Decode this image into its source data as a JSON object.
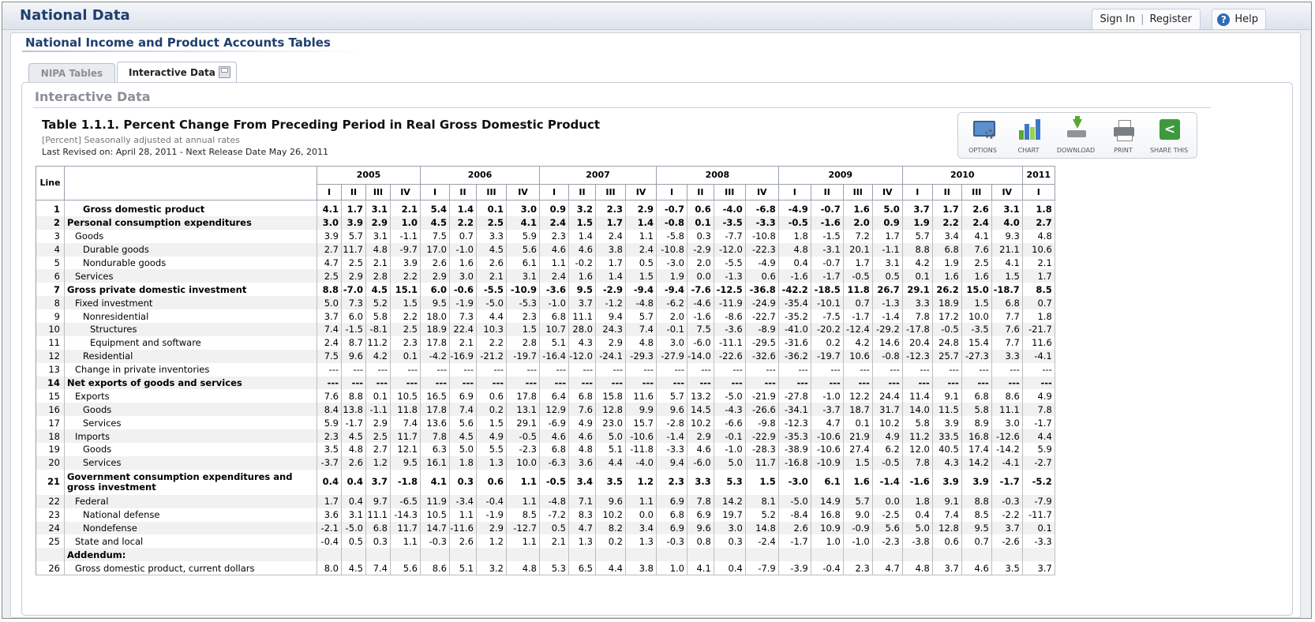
{
  "app": {
    "title": "National Data"
  },
  "auth": {
    "sign_in": "Sign In",
    "register": "Register",
    "help": "Help"
  },
  "panel": {
    "title": "National Income and Product Accounts Tables"
  },
  "tabs": [
    {
      "label": "NIPA Tables"
    },
    {
      "label": "Interactive Data"
    }
  ],
  "section": {
    "title": "Interactive Data"
  },
  "table_meta": {
    "title": "Table 1.1.1. Percent Change From Preceding Period in Real Gross Domestic Product",
    "subtitle": "[Percent] Seasonally adjusted at annual rates",
    "revised": "Last Revised on: April 28, 2011 - Next Release Date May 26, 2011"
  },
  "toolbar": {
    "options": "OPTIONS",
    "chart": "CHART",
    "download": "DOWNLOAD",
    "print": "PRINT",
    "share": "SHARE THIS"
  },
  "icons": {
    "options": "options-icon",
    "chart": "chart-icon",
    "download": "download-icon",
    "print": "print-icon",
    "share": "share-icon",
    "save": "save-icon",
    "help": "help-icon"
  },
  "colors": {
    "title": "#1f3f6e",
    "row_alt": "#f1f1f1",
    "share_green": "#3c9a3c",
    "chart_bars": [
      "#5aa832",
      "#3c78c8",
      "#9ccc5a"
    ]
  },
  "columns": {
    "line_header": "Line",
    "years": [
      {
        "year": "2005",
        "span": 4
      },
      {
        "year": "2006",
        "span": 4
      },
      {
        "year": "2007",
        "span": 4
      },
      {
        "year": "2008",
        "span": 4
      },
      {
        "year": "2009",
        "span": 4
      },
      {
        "year": "2010",
        "span": 4
      },
      {
        "year": "2011",
        "span": 1
      }
    ],
    "quarters": [
      "I",
      "II",
      "III",
      "IV",
      "I",
      "II",
      "III",
      "IV",
      "I",
      "II",
      "III",
      "IV",
      "I",
      "II",
      "III",
      "IV",
      "I",
      "II",
      "III",
      "IV",
      "I",
      "II",
      "III",
      "IV",
      "I"
    ]
  },
  "rows": [
    {
      "line": "1",
      "label": "Gross domestic product",
      "indent": 2,
      "bold": true,
      "values": [
        "4.1",
        "1.7",
        "3.1",
        "2.1",
        "5.4",
        "1.4",
        "0.1",
        "3.0",
        "0.9",
        "3.2",
        "2.3",
        "2.9",
        "-0.7",
        "0.6",
        "-4.0",
        "-6.8",
        "-4.9",
        "-0.7",
        "1.6",
        "5.0",
        "3.7",
        "1.7",
        "2.6",
        "3.1",
        "1.8"
      ]
    },
    {
      "line": "2",
      "label": "Personal consumption expenditures",
      "indent": 0,
      "bold": true,
      "values": [
        "3.0",
        "3.9",
        "2.9",
        "1.0",
        "4.5",
        "2.2",
        "2.5",
        "4.1",
        "2.4",
        "1.5",
        "1.7",
        "1.4",
        "-0.8",
        "0.1",
        "-3.5",
        "-3.3",
        "-0.5",
        "-1.6",
        "2.0",
        "0.9",
        "1.9",
        "2.2",
        "2.4",
        "4.0",
        "2.7"
      ]
    },
    {
      "line": "3",
      "label": "Goods",
      "indent": 1,
      "bold": false,
      "values": [
        "3.9",
        "5.7",
        "3.1",
        "-1.1",
        "7.5",
        "0.7",
        "3.3",
        "5.9",
        "2.3",
        "1.4",
        "2.4",
        "1.1",
        "-5.8",
        "0.3",
        "-7.7",
        "-10.8",
        "1.8",
        "-1.5",
        "7.2",
        "1.7",
        "5.7",
        "3.4",
        "4.1",
        "9.3",
        "4.8"
      ]
    },
    {
      "line": "4",
      "label": "Durable goods",
      "indent": 2,
      "bold": false,
      "values": [
        "2.7",
        "11.7",
        "4.8",
        "-9.7",
        "17.0",
        "-1.0",
        "4.5",
        "5.6",
        "4.6",
        "4.6",
        "3.8",
        "2.4",
        "-10.8",
        "-2.9",
        "-12.0",
        "-22.3",
        "4.8",
        "-3.1",
        "20.1",
        "-1.1",
        "8.8",
        "6.8",
        "7.6",
        "21.1",
        "10.6"
      ]
    },
    {
      "line": "5",
      "label": "Nondurable goods",
      "indent": 2,
      "bold": false,
      "values": [
        "4.7",
        "2.5",
        "2.1",
        "3.9",
        "2.6",
        "1.6",
        "2.6",
        "6.1",
        "1.1",
        "-0.2",
        "1.7",
        "0.5",
        "-3.0",
        "2.0",
        "-5.5",
        "-4.9",
        "0.4",
        "-0.7",
        "1.7",
        "3.1",
        "4.2",
        "1.9",
        "2.5",
        "4.1",
        "2.1"
      ]
    },
    {
      "line": "6",
      "label": "Services",
      "indent": 1,
      "bold": false,
      "values": [
        "2.5",
        "2.9",
        "2.8",
        "2.2",
        "2.9",
        "3.0",
        "2.1",
        "3.1",
        "2.4",
        "1.6",
        "1.4",
        "1.5",
        "1.9",
        "0.0",
        "-1.3",
        "0.6",
        "-1.6",
        "-1.7",
        "-0.5",
        "0.5",
        "0.1",
        "1.6",
        "1.6",
        "1.5",
        "1.7"
      ]
    },
    {
      "line": "7",
      "label": "Gross private domestic investment",
      "indent": 0,
      "bold": true,
      "values": [
        "8.8",
        "-7.0",
        "4.5",
        "15.1",
        "6.0",
        "-0.6",
        "-5.5",
        "-10.9",
        "-3.6",
        "9.5",
        "-2.9",
        "-9.4",
        "-9.4",
        "-7.6",
        "-12.5",
        "-36.8",
        "-42.2",
        "-18.5",
        "11.8",
        "26.7",
        "29.1",
        "26.2",
        "15.0",
        "-18.7",
        "8.5"
      ]
    },
    {
      "line": "8",
      "label": "Fixed investment",
      "indent": 1,
      "bold": false,
      "values": [
        "5.0",
        "7.3",
        "5.2",
        "1.5",
        "9.5",
        "-1.9",
        "-5.0",
        "-5.3",
        "-1.0",
        "3.7",
        "-1.2",
        "-4.8",
        "-6.2",
        "-4.6",
        "-11.9",
        "-24.9",
        "-35.4",
        "-10.1",
        "0.7",
        "-1.3",
        "3.3",
        "18.9",
        "1.5",
        "6.8",
        "0.7"
      ]
    },
    {
      "line": "9",
      "label": "Nonresidential",
      "indent": 2,
      "bold": false,
      "values": [
        "3.7",
        "6.0",
        "5.8",
        "2.2",
        "18.0",
        "7.3",
        "4.4",
        "2.3",
        "6.8",
        "11.1",
        "9.4",
        "5.7",
        "2.0",
        "-1.6",
        "-8.6",
        "-22.7",
        "-35.2",
        "-7.5",
        "-1.7",
        "-1.4",
        "7.8",
        "17.2",
        "10.0",
        "7.7",
        "1.8"
      ]
    },
    {
      "line": "10",
      "label": "Structures",
      "indent": 3,
      "bold": false,
      "values": [
        "7.4",
        "-1.5",
        "-8.1",
        "2.5",
        "18.9",
        "22.4",
        "10.3",
        "1.5",
        "10.7",
        "28.0",
        "24.3",
        "7.4",
        "-0.1",
        "7.5",
        "-3.6",
        "-8.9",
        "-41.0",
        "-20.2",
        "-12.4",
        "-29.2",
        "-17.8",
        "-0.5",
        "-3.5",
        "7.6",
        "-21.7"
      ]
    },
    {
      "line": "11",
      "label": "Equipment and software",
      "indent": 3,
      "bold": false,
      "values": [
        "2.4",
        "8.7",
        "11.2",
        "2.3",
        "17.8",
        "2.1",
        "2.2",
        "2.8",
        "5.1",
        "4.3",
        "2.9",
        "4.8",
        "3.0",
        "-6.0",
        "-11.1",
        "-29.5",
        "-31.6",
        "0.2",
        "4.2",
        "14.6",
        "20.4",
        "24.8",
        "15.4",
        "7.7",
        "11.6"
      ]
    },
    {
      "line": "12",
      "label": "Residential",
      "indent": 2,
      "bold": false,
      "values": [
        "7.5",
        "9.6",
        "4.2",
        "0.1",
        "-4.2",
        "-16.9",
        "-21.2",
        "-19.7",
        "-16.4",
        "-12.0",
        "-24.1",
        "-29.3",
        "-27.9",
        "-14.0",
        "-22.6",
        "-32.6",
        "-36.2",
        "-19.7",
        "10.6",
        "-0.8",
        "-12.3",
        "25.7",
        "-27.3",
        "3.3",
        "-4.1"
      ]
    },
    {
      "line": "13",
      "label": "Change in private inventories",
      "indent": 1,
      "bold": false,
      "values": [
        "---",
        "---",
        "---",
        "---",
        "---",
        "---",
        "---",
        "---",
        "---",
        "---",
        "---",
        "---",
        "---",
        "---",
        "---",
        "---",
        "---",
        "---",
        "---",
        "---",
        "---",
        "---",
        "---",
        "---",
        "---"
      ]
    },
    {
      "line": "14",
      "label": "Net exports of goods and services",
      "indent": 0,
      "bold": true,
      "values": [
        "---",
        "---",
        "---",
        "---",
        "---",
        "---",
        "---",
        "---",
        "---",
        "---",
        "---",
        "---",
        "---",
        "---",
        "---",
        "---",
        "---",
        "---",
        "---",
        "---",
        "---",
        "---",
        "---",
        "---",
        "---"
      ]
    },
    {
      "line": "15",
      "label": "Exports",
      "indent": 1,
      "bold": false,
      "values": [
        "7.6",
        "8.8",
        "0.1",
        "10.5",
        "16.5",
        "6.9",
        "0.6",
        "17.8",
        "6.4",
        "6.8",
        "15.8",
        "11.6",
        "5.7",
        "13.2",
        "-5.0",
        "-21.9",
        "-27.8",
        "-1.0",
        "12.2",
        "24.4",
        "11.4",
        "9.1",
        "6.8",
        "8.6",
        "4.9"
      ]
    },
    {
      "line": "16",
      "label": "Goods",
      "indent": 2,
      "bold": false,
      "values": [
        "8.4",
        "13.8",
        "-1.1",
        "11.8",
        "17.8",
        "7.4",
        "0.2",
        "13.1",
        "12.9",
        "7.6",
        "12.8",
        "9.9",
        "9.6",
        "14.5",
        "-4.3",
        "-26.6",
        "-34.1",
        "-3.7",
        "18.7",
        "31.7",
        "14.0",
        "11.5",
        "5.8",
        "11.1",
        "7.8"
      ]
    },
    {
      "line": "17",
      "label": "Services",
      "indent": 2,
      "bold": false,
      "values": [
        "5.9",
        "-1.7",
        "2.9",
        "7.4",
        "13.6",
        "5.6",
        "1.5",
        "29.1",
        "-6.9",
        "4.9",
        "23.0",
        "15.7",
        "-2.8",
        "10.2",
        "-6.6",
        "-9.8",
        "-12.3",
        "4.7",
        "0.1",
        "10.2",
        "5.8",
        "3.9",
        "8.9",
        "3.0",
        "-1.7"
      ]
    },
    {
      "line": "18",
      "label": "Imports",
      "indent": 1,
      "bold": false,
      "values": [
        "2.3",
        "4.5",
        "2.5",
        "11.7",
        "7.8",
        "4.5",
        "4.9",
        "-0.5",
        "4.6",
        "4.6",
        "5.0",
        "-10.6",
        "-1.4",
        "2.9",
        "-0.1",
        "-22.9",
        "-35.3",
        "-10.6",
        "21.9",
        "4.9",
        "11.2",
        "33.5",
        "16.8",
        "-12.6",
        "4.4"
      ]
    },
    {
      "line": "19",
      "label": "Goods",
      "indent": 2,
      "bold": false,
      "values": [
        "3.5",
        "4.8",
        "2.7",
        "12.1",
        "6.3",
        "5.0",
        "5.5",
        "-2.3",
        "6.8",
        "4.8",
        "5.1",
        "-11.8",
        "-3.3",
        "4.6",
        "-1.0",
        "-28.3",
        "-38.9",
        "-10.6",
        "27.4",
        "6.2",
        "12.0",
        "40.5",
        "17.4",
        "-14.2",
        "5.9"
      ]
    },
    {
      "line": "20",
      "label": "Services",
      "indent": 2,
      "bold": false,
      "values": [
        "-3.7",
        "2.6",
        "1.2",
        "9.5",
        "16.1",
        "1.8",
        "1.3",
        "10.0",
        "-6.3",
        "3.6",
        "4.4",
        "-4.0",
        "9.4",
        "-6.0",
        "5.0",
        "11.7",
        "-16.8",
        "-10.9",
        "1.5",
        "-0.5",
        "7.8",
        "4.3",
        "14.2",
        "-4.1",
        "-2.7"
      ]
    },
    {
      "line": "21",
      "label": "Government consumption expenditures and gross investment",
      "indent": 0,
      "bold": true,
      "tall": true,
      "values": [
        "0.4",
        "0.4",
        "3.7",
        "-1.8",
        "4.1",
        "0.3",
        "0.6",
        "1.1",
        "-0.5",
        "3.4",
        "3.5",
        "1.2",
        "2.3",
        "3.3",
        "5.3",
        "1.5",
        "-3.0",
        "6.1",
        "1.6",
        "-1.4",
        "-1.6",
        "3.9",
        "3.9",
        "-1.7",
        "-5.2"
      ]
    },
    {
      "line": "22",
      "label": "Federal",
      "indent": 1,
      "bold": false,
      "values": [
        "1.7",
        "0.4",
        "9.7",
        "-6.5",
        "11.9",
        "-3.4",
        "-0.4",
        "1.1",
        "-4.8",
        "7.1",
        "9.6",
        "1.1",
        "6.9",
        "7.8",
        "14.2",
        "8.1",
        "-5.0",
        "14.9",
        "5.7",
        "0.0",
        "1.8",
        "9.1",
        "8.8",
        "-0.3",
        "-7.9"
      ]
    },
    {
      "line": "23",
      "label": "National defense",
      "indent": 2,
      "bold": false,
      "values": [
        "3.6",
        "3.1",
        "11.1",
        "-14.3",
        "10.5",
        "1.1",
        "-1.9",
        "8.5",
        "-7.2",
        "8.3",
        "10.2",
        "0.0",
        "6.8",
        "6.9",
        "19.7",
        "5.2",
        "-8.4",
        "16.8",
        "9.0",
        "-2.5",
        "0.4",
        "7.4",
        "8.5",
        "-2.2",
        "-11.7"
      ]
    },
    {
      "line": "24",
      "label": "Nondefense",
      "indent": 2,
      "bold": false,
      "values": [
        "-2.1",
        "-5.0",
        "6.8",
        "11.7",
        "14.7",
        "-11.6",
        "2.9",
        "-12.7",
        "0.5",
        "4.7",
        "8.2",
        "3.4",
        "6.9",
        "9.6",
        "3.0",
        "14.8",
        "2.6",
        "10.9",
        "-0.9",
        "5.6",
        "5.0",
        "12.8",
        "9.5",
        "3.7",
        "0.1"
      ]
    },
    {
      "line": "25",
      "label": "State and local",
      "indent": 1,
      "bold": false,
      "values": [
        "-0.4",
        "0.5",
        "0.3",
        "1.1",
        "-0.3",
        "2.6",
        "1.2",
        "1.1",
        "2.1",
        "1.3",
        "0.2",
        "1.3",
        "-0.3",
        "0.8",
        "0.3",
        "-2.4",
        "-1.7",
        "1.0",
        "-1.0",
        "-2.3",
        "-3.8",
        "0.6",
        "0.7",
        "-2.6",
        "-3.3"
      ]
    },
    {
      "line": "",
      "label": "Addendum:",
      "indent": 0,
      "bold": true,
      "values": [
        "",
        "",
        "",
        "",
        "",
        "",
        "",
        "",
        "",
        "",
        "",
        "",
        "",
        "",
        "",
        "",
        "",
        "",
        "",
        "",
        "",
        "",
        "",
        "",
        ""
      ]
    },
    {
      "line": "26",
      "label": "Gross domestic product, current dollars",
      "indent": 1,
      "bold": false,
      "values": [
        "8.0",
        "4.5",
        "7.4",
        "5.6",
        "8.6",
        "5.1",
        "3.2",
        "4.8",
        "5.3",
        "6.5",
        "4.4",
        "3.8",
        "1.0",
        "4.1",
        "0.4",
        "-7.9",
        "-3.9",
        "-0.4",
        "2.3",
        "4.7",
        "4.8",
        "3.7",
        "4.6",
        "3.5",
        "3.7"
      ]
    }
  ]
}
